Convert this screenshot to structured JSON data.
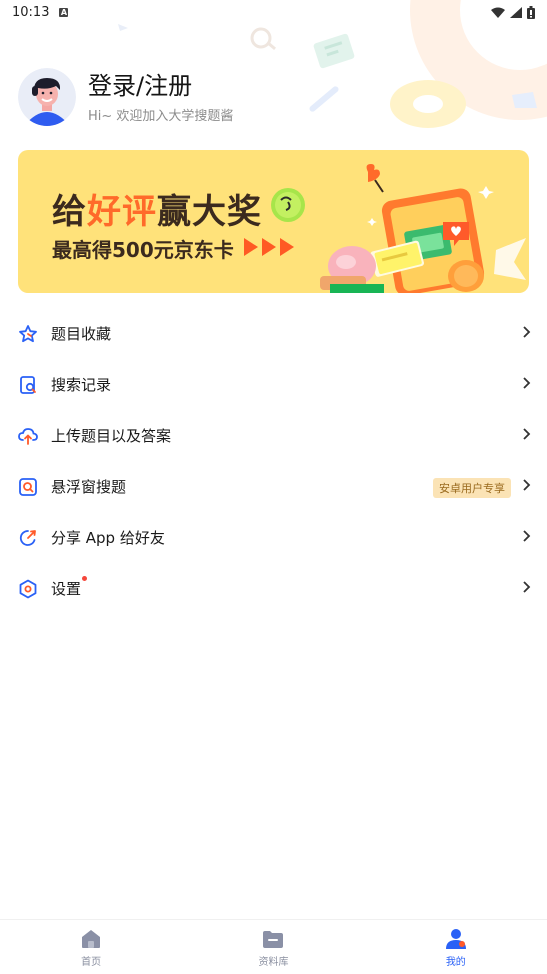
{
  "status_bar": {
    "time": "10:13"
  },
  "profile": {
    "title": "登录/注册",
    "subtitle": "Hi~ 欢迎加入大学搜题酱"
  },
  "banner": {
    "title_part1": "给",
    "title_part2": "好评",
    "title_part3": "赢大奖",
    "subtitle": "最高得500元京东卡"
  },
  "menu": [
    {
      "label": "题目收藏",
      "icon": "star-icon"
    },
    {
      "label": "搜索记录",
      "icon": "search-history-icon"
    },
    {
      "label": "上传题目以及答案",
      "icon": "upload-icon"
    },
    {
      "label": "悬浮窗搜题",
      "icon": "floating-search-icon",
      "badge": "安卓用户专享"
    },
    {
      "label": "分享 App 给好友",
      "icon": "share-icon"
    },
    {
      "label": "设置",
      "icon": "settings-icon",
      "dot": true
    }
  ],
  "bottom_nav": [
    {
      "label": "首页",
      "icon": "home-icon",
      "active": false
    },
    {
      "label": "资料库",
      "icon": "folder-icon",
      "active": false
    },
    {
      "label": "我的",
      "icon": "profile-icon",
      "active": true
    }
  ],
  "colors": {
    "accent": "#2a61f6",
    "banner_bg": "#ffe27a",
    "banner_highlight": "#ff6a2a",
    "badge_bg": "#fbe3b5",
    "dot": "#f5473b"
  }
}
